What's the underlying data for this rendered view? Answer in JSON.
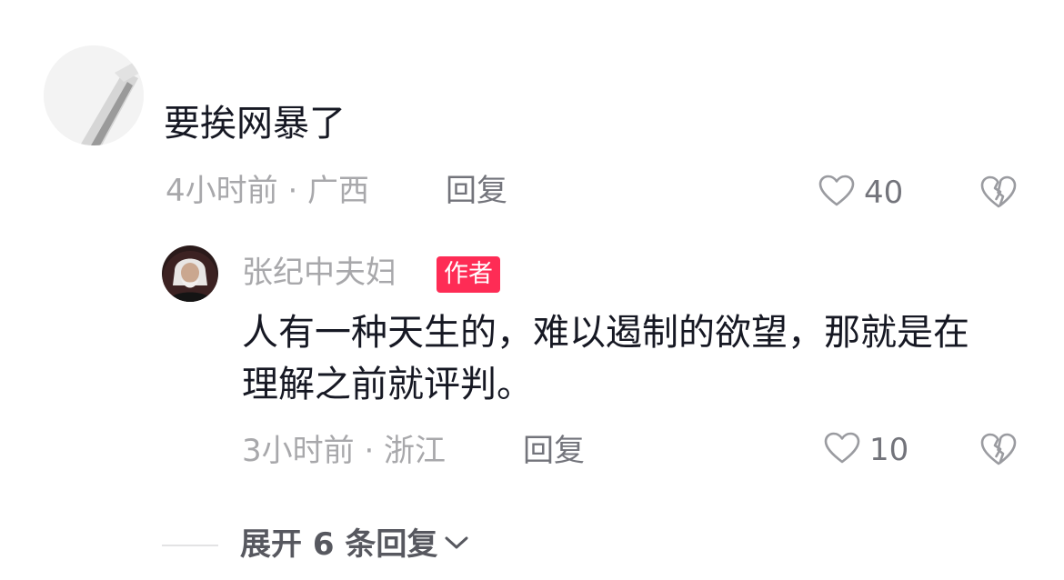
{
  "colors": {
    "text_primary": "#161823",
    "text_secondary": "#a8a8ab",
    "text_action": "#73747b",
    "author_badge_bg": "#fe2c55"
  },
  "comment": {
    "text": "要挨网暴了",
    "meta": "4小时前 · 广西",
    "reply_label": "回复",
    "like_count": "40",
    "like_icon": "heart-outline-icon",
    "dislike_icon": "broken-heart-icon"
  },
  "reply": {
    "author": "张纪中夫妇",
    "author_badge": "作者",
    "text": "人有一种天生的，难以遏制的欲望，那就是在理解之前就评判。",
    "meta": "3小时前 · 浙江",
    "reply_label": "回复",
    "like_count": "10",
    "like_icon": "heart-outline-icon",
    "dislike_icon": "broken-heart-icon"
  },
  "expand": {
    "label": "展开 6 条回复",
    "icon": "chevron-down-icon"
  }
}
